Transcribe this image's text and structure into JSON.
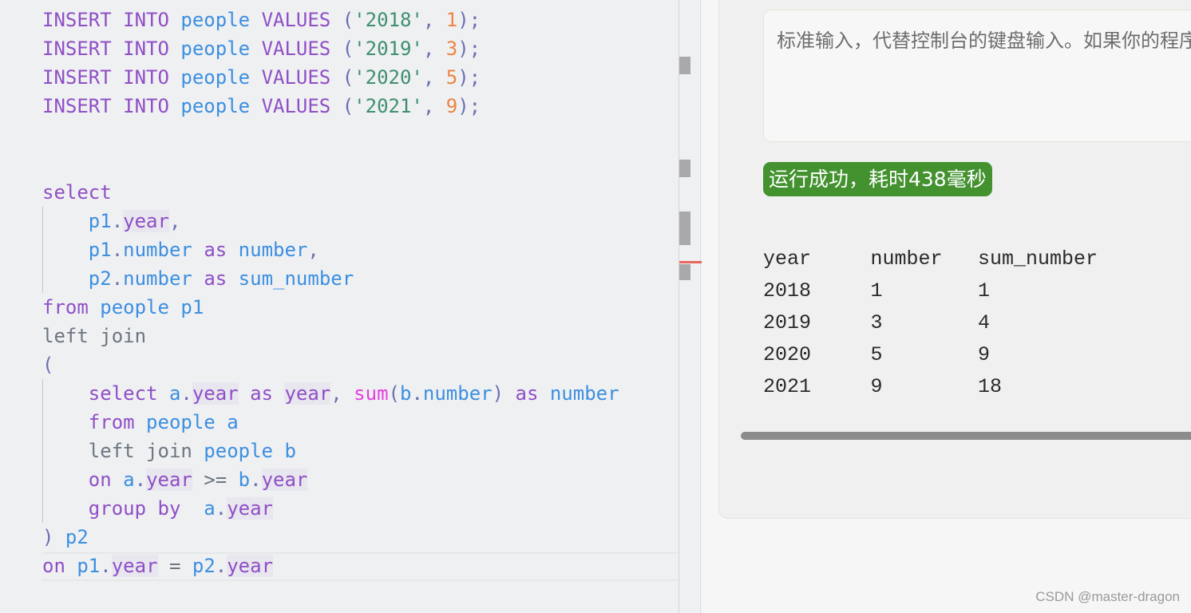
{
  "editor": {
    "lines": [
      [
        [
          "INSERT",
          "kw"
        ],
        [
          " "
        ],
        [
          "INTO",
          "kw"
        ],
        [
          " "
        ],
        [
          "people",
          "id"
        ],
        [
          " "
        ],
        [
          "VALUES",
          "kw"
        ],
        [
          " "
        ],
        [
          "(",
          "punc"
        ],
        [
          "'2018'",
          "str"
        ],
        [
          ",",
          "punc"
        ],
        [
          " "
        ],
        [
          "1",
          "num"
        ],
        [
          ");",
          "punc"
        ]
      ],
      [
        [
          "INSERT",
          "kw"
        ],
        [
          " "
        ],
        [
          "INTO",
          "kw"
        ],
        [
          " "
        ],
        [
          "people",
          "id"
        ],
        [
          " "
        ],
        [
          "VALUES",
          "kw"
        ],
        [
          " "
        ],
        [
          "(",
          "punc"
        ],
        [
          "'2019'",
          "str"
        ],
        [
          ",",
          "punc"
        ],
        [
          " "
        ],
        [
          "3",
          "num"
        ],
        [
          ");",
          "punc"
        ]
      ],
      [
        [
          "INSERT",
          "kw"
        ],
        [
          " "
        ],
        [
          "INTO",
          "kw"
        ],
        [
          " "
        ],
        [
          "people",
          "id"
        ],
        [
          " "
        ],
        [
          "VALUES",
          "kw"
        ],
        [
          " "
        ],
        [
          "(",
          "punc"
        ],
        [
          "'2020'",
          "str"
        ],
        [
          ",",
          "punc"
        ],
        [
          " "
        ],
        [
          "5",
          "num"
        ],
        [
          ");",
          "punc"
        ]
      ],
      [
        [
          "INSERT",
          "kw"
        ],
        [
          " "
        ],
        [
          "INTO",
          "kw"
        ],
        [
          " "
        ],
        [
          "people",
          "id"
        ],
        [
          " "
        ],
        [
          "VALUES",
          "kw"
        ],
        [
          " "
        ],
        [
          "(",
          "punc"
        ],
        [
          "'2021'",
          "str"
        ],
        [
          ",",
          "punc"
        ],
        [
          " "
        ],
        [
          "9",
          "num"
        ],
        [
          ");",
          "punc"
        ]
      ],
      [],
      [],
      [
        [
          "select",
          "kw"
        ]
      ],
      [
        [
          "    "
        ],
        [
          "p1",
          "id"
        ],
        [
          ".",
          "punc"
        ],
        [
          "year",
          "prop"
        ],
        [
          ",",
          "punc"
        ]
      ],
      [
        [
          "    "
        ],
        [
          "p1",
          "id"
        ],
        [
          ".",
          "punc"
        ],
        [
          "number",
          "id"
        ],
        [
          " "
        ],
        [
          "as",
          "kw"
        ],
        [
          " "
        ],
        [
          "number",
          "id"
        ],
        [
          ",",
          "punc"
        ]
      ],
      [
        [
          "    "
        ],
        [
          "p2",
          "id"
        ],
        [
          ".",
          "punc"
        ],
        [
          "number",
          "id"
        ],
        [
          " "
        ],
        [
          "as",
          "kw"
        ],
        [
          " "
        ],
        [
          "sum_number",
          "id"
        ]
      ],
      [
        [
          "from",
          "kw"
        ],
        [
          " "
        ],
        [
          "people",
          "id"
        ],
        [
          " "
        ],
        [
          "p1",
          "id"
        ]
      ],
      [
        [
          "left join",
          "plain"
        ]
      ],
      [
        [
          "(",
          "punc"
        ]
      ],
      [
        [
          "    "
        ],
        [
          "select",
          "kw"
        ],
        [
          " "
        ],
        [
          "a",
          "id"
        ],
        [
          ".",
          "punc"
        ],
        [
          "year",
          "prop"
        ],
        [
          " "
        ],
        [
          "as",
          "kw"
        ],
        [
          " "
        ],
        [
          "year",
          "prop"
        ],
        [
          ",",
          "punc"
        ],
        [
          " "
        ],
        [
          "sum",
          "fn"
        ],
        [
          "(",
          "punc"
        ],
        [
          "b",
          "id"
        ],
        [
          ".",
          "punc"
        ],
        [
          "number",
          "id"
        ],
        [
          ")",
          "punc"
        ],
        [
          " "
        ],
        [
          "as",
          "kw"
        ],
        [
          " "
        ],
        [
          "number",
          "id"
        ]
      ],
      [
        [
          "    "
        ],
        [
          "from",
          "kw"
        ],
        [
          " "
        ],
        [
          "people",
          "id"
        ],
        [
          " "
        ],
        [
          "a",
          "id"
        ]
      ],
      [
        [
          "    "
        ],
        [
          "left join",
          "plain"
        ],
        [
          " "
        ],
        [
          "people",
          "id"
        ],
        [
          " "
        ],
        [
          "b",
          "id"
        ]
      ],
      [
        [
          "    "
        ],
        [
          "on",
          "kw"
        ],
        [
          " "
        ],
        [
          "a",
          "id"
        ],
        [
          ".",
          "punc"
        ],
        [
          "year",
          "prop"
        ],
        [
          " "
        ],
        [
          ">=",
          "plain"
        ],
        [
          " "
        ],
        [
          "b",
          "id"
        ],
        [
          ".",
          "punc"
        ],
        [
          "year",
          "prop"
        ]
      ],
      [
        [
          "    "
        ],
        [
          "group by",
          "kw"
        ],
        [
          "  "
        ],
        [
          "a",
          "id"
        ],
        [
          ".",
          "punc"
        ],
        [
          "year",
          "prop"
        ]
      ],
      [
        [
          ")",
          "punc"
        ],
        [
          " "
        ],
        [
          "p2",
          "id"
        ]
      ],
      [
        [
          "on",
          "kw"
        ],
        [
          " "
        ],
        [
          "p1",
          "id"
        ],
        [
          ".",
          "punc"
        ],
        [
          "year",
          "prop"
        ],
        [
          " "
        ],
        [
          "=",
          "plain"
        ],
        [
          " "
        ],
        [
          "p2",
          "id"
        ],
        [
          ".",
          "punc"
        ],
        [
          "year",
          "prop"
        ]
      ]
    ]
  },
  "stdin": {
    "placeholder": "标准输入，代替控制台的键盘输入。如果你的程序需要"
  },
  "status": {
    "text": "运行成功，耗时438毫秒",
    "color": "#43922f"
  },
  "result": {
    "columns": [
      "year",
      "number",
      "sum_number"
    ],
    "rows": [
      [
        "2018",
        "1",
        "1"
      ],
      [
        "2019",
        "3",
        "4"
      ],
      [
        "2020",
        "5",
        "9"
      ],
      [
        "2021",
        "9",
        "18"
      ]
    ]
  },
  "watermark": "CSDN @master-dragon"
}
